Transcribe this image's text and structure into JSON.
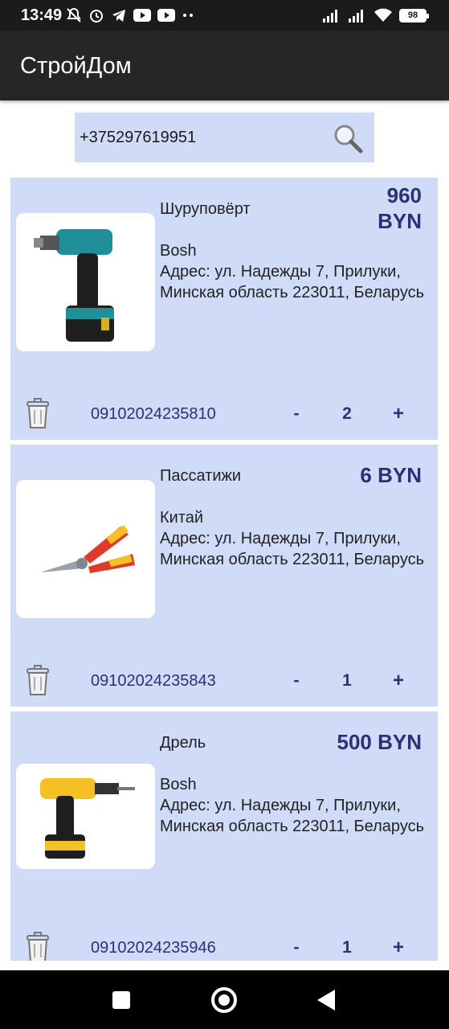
{
  "status_bar": {
    "time": "13:49",
    "battery": "98",
    "left_icons": [
      "mute-icon",
      "alarm-icon",
      "telegram-icon",
      "youtube-icon",
      "youtube-icon",
      "more-dots-icon"
    ],
    "right_icons": [
      "signal-icon",
      "signal-icon",
      "wifi-icon",
      "battery-icon"
    ]
  },
  "app_bar": {
    "title": "СтройДом"
  },
  "search": {
    "value": "+375297619951",
    "icon": "search-icon"
  },
  "colors": {
    "card_bg": "#d0dbf7",
    "accent_text": "#2a3275",
    "app_bar": "#262626"
  },
  "items": [
    {
      "name": "Шуруповёрт",
      "price_line1": "960",
      "price_line2": "BYN",
      "brand": "Bosh",
      "address": "Адрес: ул. Надежды 7, Прилуки, Минская область 223011, Беларусь",
      "article": "09102024235810",
      "minus": "-",
      "quantity": "2",
      "plus": "+",
      "image": "cordless-screwdriver-image"
    },
    {
      "name": "Пассатижи",
      "price_line1": "6 BYN",
      "price_line2": "",
      "brand": "Китай",
      "address": "Адрес: ул. Надежды 7, Прилуки, Минская область 223011, Беларусь",
      "article": "09102024235843",
      "minus": "-",
      "quantity": "1",
      "plus": "+",
      "image": "pliers-image"
    },
    {
      "name": "Дрель",
      "price_line1": "500 BYN",
      "price_line2": "",
      "brand": "Bosh",
      "address": "Адрес: ул. Надежды 7, Прилуки, Минская область 223011, Беларусь",
      "article": "09102024235946",
      "minus": "-",
      "quantity": "1",
      "plus": "+",
      "image": "drill-image"
    }
  ],
  "nav_bar": {
    "buttons": [
      "recents-button",
      "home-button",
      "back-button"
    ]
  }
}
